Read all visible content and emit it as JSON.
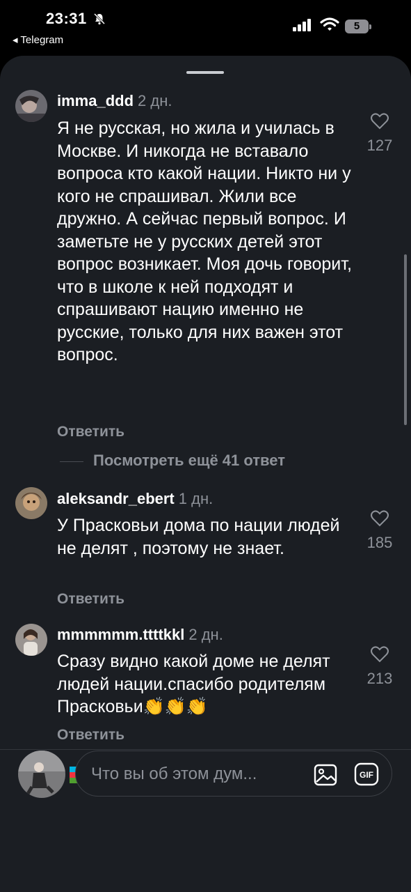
{
  "status": {
    "time": "23:31",
    "back_app": "◂ Telegram",
    "battery": "5"
  },
  "comments": [
    {
      "username": "imma_ddd",
      "time": "2 дн.",
      "text": "Я не русская, но жила и училась в Москве. И никогда не вставало вопроса кто какой нации. Никто ни у кого не спрашивал. Жили все дружно. А сейчас первый вопрос. И заметьте не у русских детей этот вопрос возникает.  Моя дочь говорит, что в школе к ней подходят и спрашивают нацию именно не русские, только для них важен этот вопрос.",
      "likes": "127",
      "reply": "Ответить"
    },
    {
      "username": "aleksandr_ebert",
      "time": "1 дн.",
      "text": "У Прасковьи дома по нации людей не делят , поэтому не знает.",
      "likes": "185",
      "reply": "Ответить"
    },
    {
      "username": "mmmmmm.ttttkkl",
      "time": "2 дн.",
      "text": "Сразу видно какой доме не делят людей нации.спасибо родителям Прасковьи👏👏👏",
      "likes": "213",
      "reply": "Ответить"
    }
  ],
  "more_replies": "Посмотреть ещё 41 ответ",
  "reactions": [
    "❤️",
    "flag-azerbaijan",
    "🔥",
    "👏",
    "😢",
    "😍",
    "😮",
    "😂"
  ],
  "composer": {
    "placeholder": "Что вы об этом дум..."
  },
  "colors": {
    "background": "#1b1e23",
    "muted": "#8e9299"
  }
}
